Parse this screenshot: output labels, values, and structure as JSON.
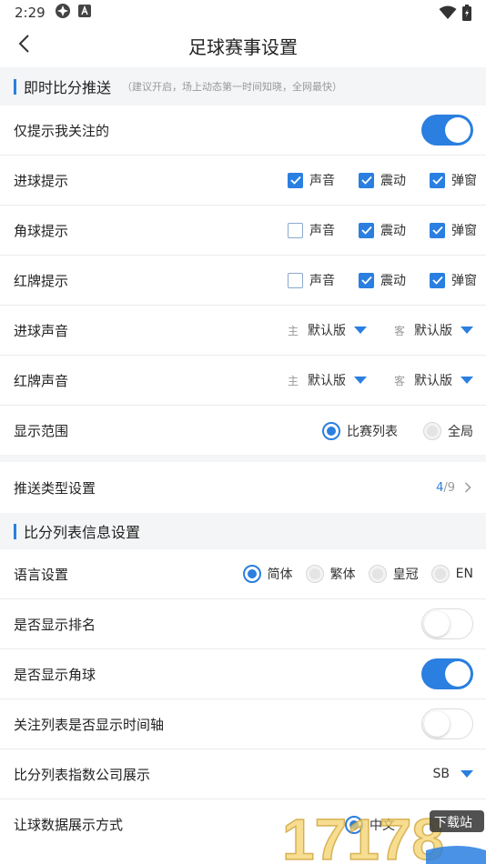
{
  "status_bar": {
    "time": "2:29",
    "icons_left": [
      "app-icon",
      "a-icon"
    ],
    "icons_right": [
      "wifi-icon",
      "battery-icon"
    ]
  },
  "header": {
    "title": "足球赛事设置",
    "back_icon": "chevron-left-icon"
  },
  "section_live": {
    "title": "即时比分推送",
    "hint": "（建议开启，场上动态第一时间知晓，全网最快）"
  },
  "rows_live": {
    "only_follow": {
      "label": "仅提示我关注的",
      "enabled": true
    },
    "goal_alert": {
      "label": "进球提示",
      "options": [
        {
          "label": "声音",
          "checked": true
        },
        {
          "label": "震动",
          "checked": true
        },
        {
          "label": "弹窗",
          "checked": true
        }
      ]
    },
    "corner_alert": {
      "label": "角球提示",
      "options": [
        {
          "label": "声音",
          "checked": false
        },
        {
          "label": "震动",
          "checked": true
        },
        {
          "label": "弹窗",
          "checked": true
        }
      ]
    },
    "red_card_alert": {
      "label": "红牌提示",
      "options": [
        {
          "label": "声音",
          "checked": false
        },
        {
          "label": "震动",
          "checked": true
        },
        {
          "label": "弹窗",
          "checked": true
        }
      ]
    },
    "goal_sound": {
      "label": "进球声音",
      "home_prefix": "主",
      "home_value": "默认版",
      "away_prefix": "客",
      "away_value": "默认版"
    },
    "red_card_sound": {
      "label": "红牌声音",
      "home_prefix": "主",
      "home_value": "默认版",
      "away_prefix": "客",
      "away_value": "默认版"
    },
    "display_range": {
      "label": "显示范围",
      "options": [
        {
          "label": "比赛列表",
          "selected": true
        },
        {
          "label": "全局",
          "selected": false
        }
      ]
    }
  },
  "push_type": {
    "label": "推送类型设置",
    "current": "4",
    "total": "/9"
  },
  "section_list": {
    "title": "比分列表信息设置"
  },
  "rows_list": {
    "language": {
      "label": "语言设置",
      "options": [
        {
          "label": "简体",
          "selected": true
        },
        {
          "label": "繁体",
          "selected": false
        },
        {
          "label": "皇冠",
          "selected": false
        },
        {
          "label": "EN",
          "selected": false
        }
      ]
    },
    "show_rank": {
      "label": "是否显示排名",
      "enabled": false
    },
    "show_corner": {
      "label": "是否显示角球",
      "enabled": true
    },
    "show_timeline": {
      "label": "关注列表是否显示时间轴",
      "enabled": false
    },
    "index_company": {
      "label": "比分列表指数公司展示",
      "value": "SB"
    },
    "handicap_display": {
      "label": "让球数据展示方式",
      "value": "中文"
    }
  },
  "watermark": {
    "text": "17178",
    "badge": "下载站"
  },
  "colors": {
    "accent": "#2a7fe0",
    "section_bg": "#f4f5f7",
    "divider": "#ececec"
  }
}
